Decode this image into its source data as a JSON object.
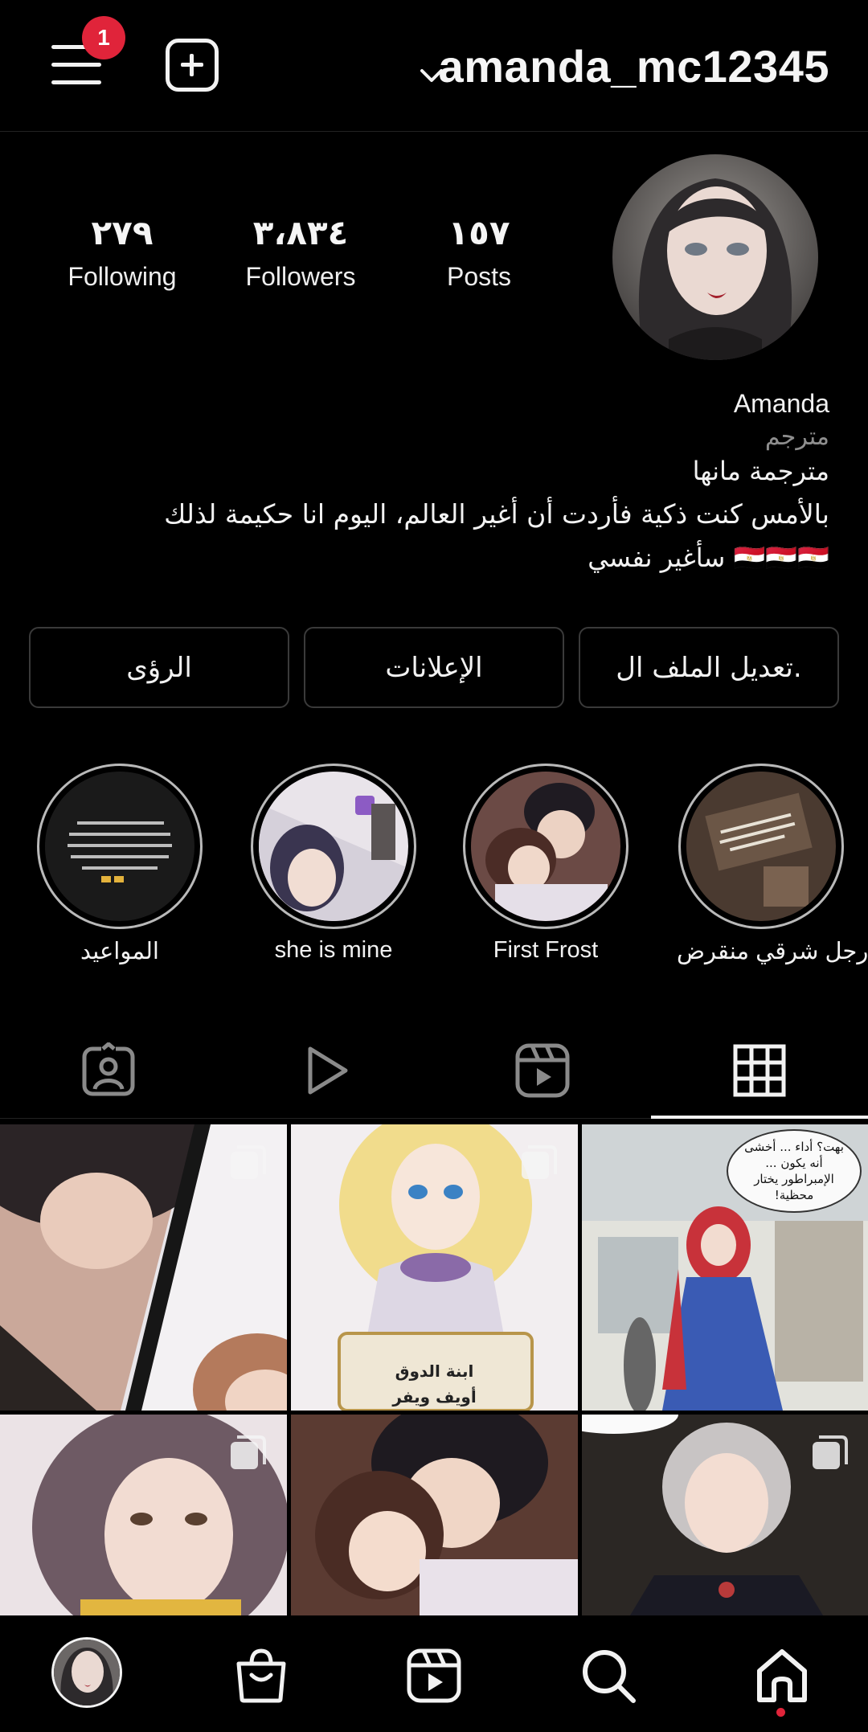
{
  "topbar": {
    "username": "amanda_mc12345",
    "notification_count": "1",
    "icons": [
      "menu-icon",
      "add-post-icon",
      "chevron-down-icon"
    ]
  },
  "profile": {
    "stats": [
      {
        "value": "٢٧٩",
        "label": "Following"
      },
      {
        "value": "٣،٨٣٤",
        "label": "Followers"
      },
      {
        "value": "١٥٧",
        "label": "Posts"
      }
    ],
    "name": "Amanda",
    "category": "مترجم",
    "bio_line1": "مترجمة مانها",
    "bio_line2": "بالأمس كنت ذكية فأردت أن أغير العالم، اليوم انا حكيمة لذلك",
    "bio_line3": "سأغير نفسي 🇪🇬🇪🇬🇪🇬"
  },
  "actions": {
    "edit_profile": "تعديل الملف ال.",
    "ads": "الإعلانات",
    "insights": "الرؤى"
  },
  "highlights": [
    {
      "label": "المواعيد"
    },
    {
      "label": "she is mine"
    },
    {
      "label": "First Frost"
    },
    {
      "label": "رجل شرقي منقرض"
    }
  ],
  "tabs": [
    "tagged-icon",
    "reels-play-icon",
    "clips-icon",
    "grid-icon"
  ],
  "grid_posts": {
    "post2_caption_1": "ابنة الدوق",
    "post2_caption_2": "أويف ويفر",
    "post3_bubble": "بهت؟ أداء ... أخشى أنه يكون ... الإمبراطور يختار محظية!"
  },
  "bottom_nav": [
    "profile-avatar",
    "shop-icon",
    "reels-icon",
    "search-icon",
    "home-icon"
  ],
  "colors": {
    "background": "#000000",
    "badge_red": "#e0243a",
    "muted": "#8e8e8e",
    "border": "#3a3a3a"
  }
}
